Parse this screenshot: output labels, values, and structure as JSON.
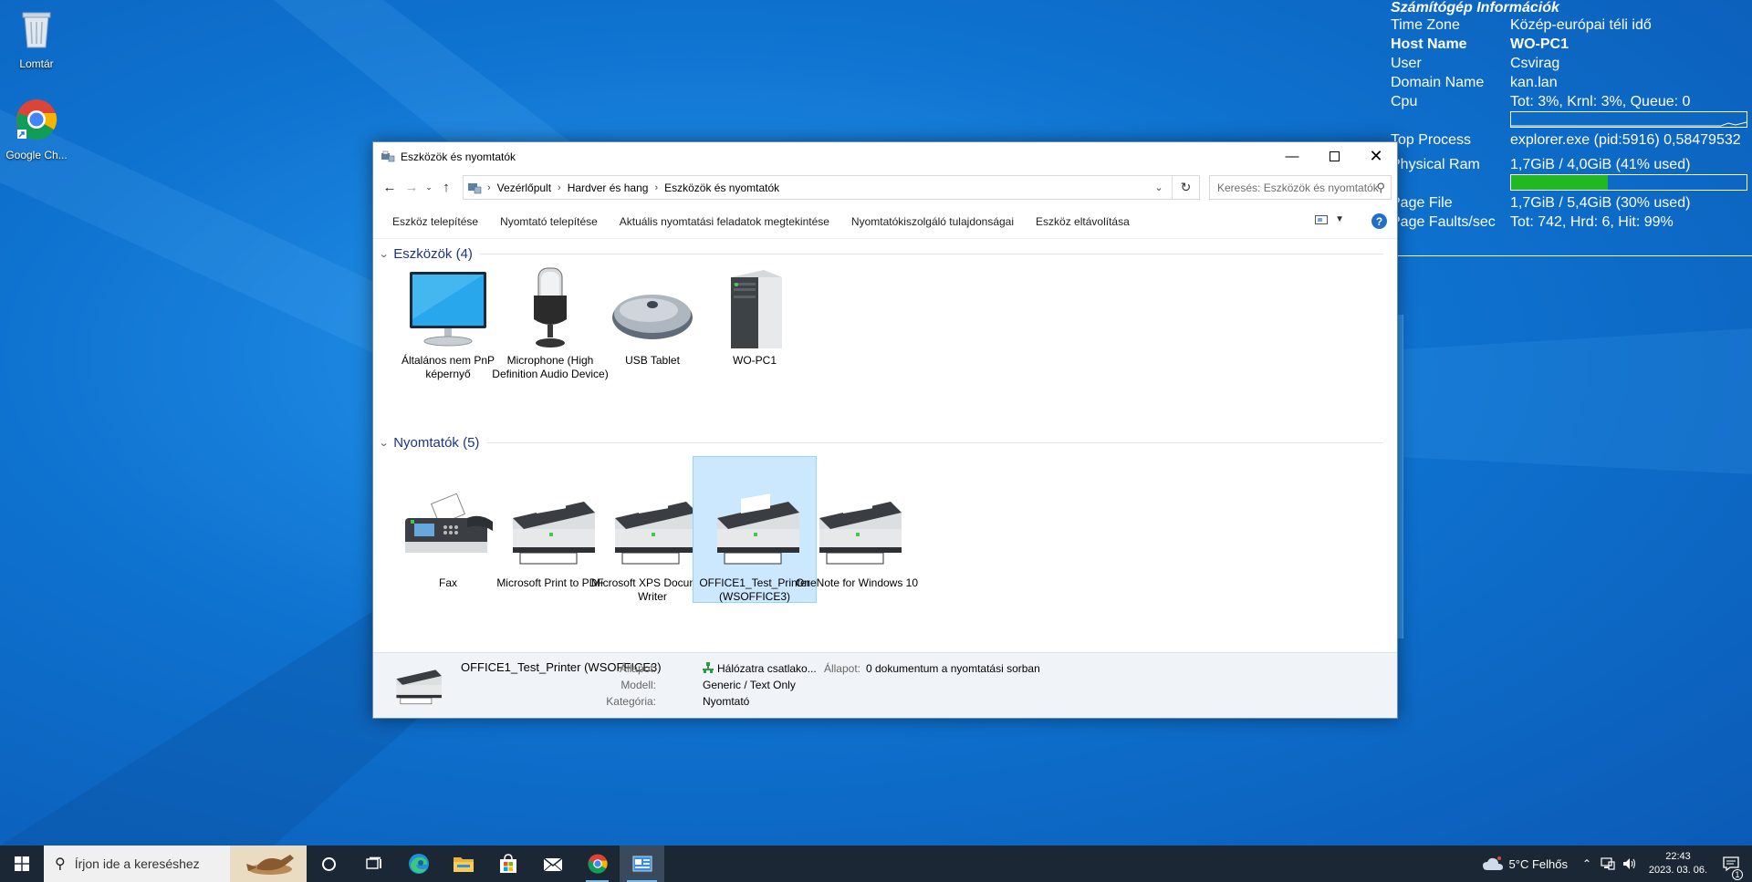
{
  "desktop": {
    "icons": [
      {
        "label": "Lomtár",
        "icon": "recycle-bin-icon"
      },
      {
        "label": "Google Ch...",
        "icon": "chrome-icon"
      }
    ]
  },
  "sysinfo": {
    "title": "Számítógép Információk",
    "rows": [
      {
        "key": "Time Zone",
        "value": "Közép-európai téli idő"
      },
      {
        "key": "Host Name",
        "value": "WO-PC1"
      },
      {
        "key": "User",
        "value": "Csvirag"
      },
      {
        "key": "Domain Name",
        "value": "kan.lan"
      },
      {
        "key": "Cpu",
        "value": "Tot:  3%, Krnl:  3%, Queue: 0"
      },
      {
        "key": "Top Process",
        "value": "explorer.exe (pid:5916) 0,58479532"
      },
      {
        "key": "Physical Ram",
        "value": "1,7GiB / 4,0GiB (41% used)"
      },
      {
        "key": "Page File",
        "value": "1,7GiB / 5,4GiB (30% used)"
      },
      {
        "key": "Page Faults/sec",
        "value": "Tot: 742, Hrd: 6, Hit: 99%"
      }
    ],
    "cpu_fraction": 0.03,
    "ram_fraction": 0.41,
    "ram_color": "#22b822"
  },
  "window": {
    "title": "Eszközök és nyomtatók",
    "breadcrumb": [
      "Vezérlőpult",
      "Hardver és hang",
      "Eszközök és nyomtatók"
    ],
    "search_placeholder": "Keresés: Eszközök és nyomtatók",
    "commands": [
      "Eszköz telepítése",
      "Nyomtató telepítése",
      "Aktuális nyomtatási feladatok megtekintése",
      "Nyomtatókiszolgáló tulajdonságai",
      "Eszköz eltávolítása"
    ],
    "help": "?",
    "groups": [
      {
        "header": "Eszközök (4)",
        "items": [
          {
            "label": "Általános nem PnP képernyő",
            "icon": "monitor-icon"
          },
          {
            "label": "Microphone (High Definition Audio Device)",
            "icon": "microphone-icon"
          },
          {
            "label": "USB Tablet",
            "icon": "mouse-icon"
          },
          {
            "label": "WO-PC1",
            "icon": "computer-tower-icon"
          }
        ]
      },
      {
        "header": "Nyomtatók (5)",
        "items": [
          {
            "label": "Fax",
            "icon": "fax-icon"
          },
          {
            "label": "Microsoft Print to PDF",
            "icon": "printer-icon"
          },
          {
            "label": "Microsoft XPS Document Writer",
            "icon": "printer-icon"
          },
          {
            "label": "OFFICE1_Test_Printer (WSOFFICE3)",
            "icon": "printer-icon",
            "selected": true
          },
          {
            "label": "OneNote for Windows 10",
            "icon": "printer-icon"
          }
        ]
      }
    ],
    "details": {
      "name": "OFFICE1_Test_Printer (WSOFFICE3)",
      "state_label": "Állapot:",
      "state_value": "Hálózatra csatlako...",
      "state2_label": "Állapot:",
      "state2_value": "0 dokumentum a nyomtatási sorban",
      "model_label": "Modell:",
      "model_value": "Generic / Text Only",
      "category_label": "Kategória:",
      "category_value": "Nyomtató"
    }
  },
  "taskbar": {
    "search_placeholder": "Írjon ide a kereséshez",
    "weather": "5°C  Felhős",
    "time": "22:43",
    "date": "2023. 03. 06.",
    "notification_count": "1"
  }
}
